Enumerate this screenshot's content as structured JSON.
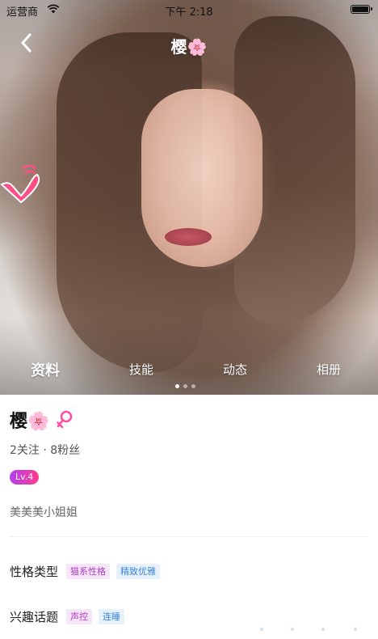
{
  "status_bar": {
    "carrier": "运营商",
    "time": "下午 2:18"
  },
  "nav": {
    "title": "樱🌸",
    "back_icon": "chevron-left-icon"
  },
  "tabs": [
    {
      "label": "资料",
      "active": true
    },
    {
      "label": "技能",
      "active": false
    },
    {
      "label": "动态",
      "active": false
    },
    {
      "label": "相册",
      "active": false
    }
  ],
  "carousel": {
    "count": 3,
    "current": 1
  },
  "profile": {
    "name": "樱🌸",
    "gender_icon": "female-symbol-icon",
    "gender_color": "#ff4fa3",
    "follow_stats": "2关注 · 8粉丝",
    "level": "Lv.4",
    "bio": "美美美小姐姐",
    "personality": {
      "label": "性格类型",
      "tags": [
        "猫系性格",
        "精致优雅"
      ]
    },
    "interests": {
      "label": "兴趣话题",
      "tags": [
        "声控",
        "连睡"
      ]
    }
  },
  "colors": {
    "accent_pink": "#ff3d8c",
    "accent_purple": "#b23ef0",
    "tag_purple_text": "#b23bc7",
    "tag_blue_text": "#3a85d8"
  }
}
